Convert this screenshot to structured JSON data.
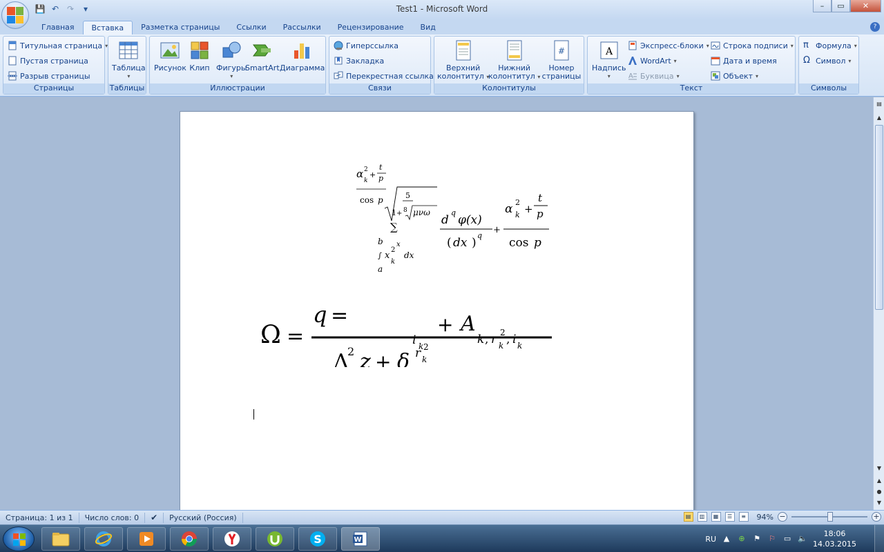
{
  "window": {
    "title": "Test1 - Microsoft Word",
    "ghost_title": "Word",
    "controls": {
      "minimize": "–",
      "maximize": "▭",
      "close": "✕"
    }
  },
  "qat": {
    "save_icon": "💾",
    "undo_icon": "↶",
    "redo_icon": "↷",
    "more_icon": "▾"
  },
  "tabs": [
    {
      "label": "Главная"
    },
    {
      "label": "Вставка",
      "active": true
    },
    {
      "label": "Разметка страницы"
    },
    {
      "label": "Ссылки"
    },
    {
      "label": "Рассылки"
    },
    {
      "label": "Рецензирование"
    },
    {
      "label": "Вид"
    }
  ],
  "ribbon": {
    "pages": {
      "label": "Страницы",
      "cover": "Титульная страница",
      "blank": "Пустая страница",
      "break": "Разрыв страницы"
    },
    "tables": {
      "label": "Таблицы",
      "table": "Таблица"
    },
    "illustrations": {
      "label": "Иллюстрации",
      "picture": "Рисунок",
      "clip": "Клип",
      "shapes": "Фигуры",
      "smartart": "SmartArt",
      "chart": "Диаграмма"
    },
    "links": {
      "label": "Связи",
      "hyperlink": "Гиперссылка",
      "bookmark": "Закладка",
      "crossref": "Перекрестная ссылка"
    },
    "headers": {
      "label": "Колонтитулы",
      "header_1": "Верхний",
      "header_2": "колонтитул",
      "footer_1": "Нижний",
      "footer_2": "колонтитул",
      "pagenum_1": "Номер",
      "pagenum_2": "страницы"
    },
    "text": {
      "label": "Текст",
      "textbox": "Надпись",
      "quickparts": "Экспресс-блоки",
      "wordart": "WordArt",
      "dropcap": "Буквица",
      "signature": "Строка подписи",
      "datetime": "Дата и время",
      "object": "Объект"
    },
    "symbols": {
      "label": "Символы",
      "equation": "Формула",
      "symbol": "Символ"
    }
  },
  "formula": {
    "alpha": "α",
    "k": "k",
    "two": "2",
    "plus": "+",
    "t": "t",
    "p": "p",
    "cos": "cos",
    "one": "1",
    "five": "5",
    "eight": "8",
    "munu": "μνω",
    "sum": "∑",
    "b": "b",
    "a": "a",
    "x": "x",
    "int": "∫",
    "dx": "dx",
    "d": "d",
    "q": "q",
    "phi_x": "φ(x)",
    "lp": "(",
    "rp": ")",
    "omega": "Ω",
    "eq": "=",
    "delta_cap": "Δ",
    "z": "z",
    "delta": "δ",
    "r": "r",
    "i": "i",
    "A": "A",
    "comma": ","
  },
  "status": {
    "page": "Страница: 1 из 1",
    "words": "Число слов: 0",
    "language": "Русский (Россия)",
    "zoom": "94%",
    "minus": "−",
    "plus": "+"
  },
  "taskbar": {
    "tray_lang": "RU",
    "time": "18:06",
    "date": "14.03.2015"
  }
}
